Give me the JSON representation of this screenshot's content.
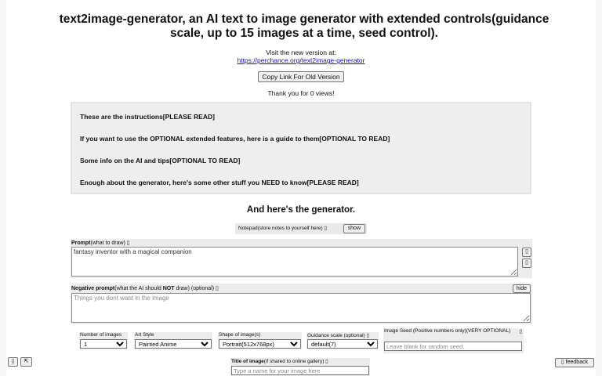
{
  "header": {
    "title": "text2image-generator, an AI text to image generator with extended controls(guidance scale, up to 15 images at a time, seed control)."
  },
  "visit": {
    "text": "Visit the new version at:",
    "link": "https://perchance.org/text2image-generator"
  },
  "copy_button": "Copy Link For Old Version",
  "views": {
    "prefix": "Thank you for ",
    "count": "0",
    "suffix": " views!"
  },
  "info_sections": [
    "These are the instructions[PLEASE READ]",
    "If you want to use the OPTIONAL extended features, here is a guide to them[OPTIONAL TO READ]",
    "Some info on the AI and tips[OPTIONAL TO READ]",
    "Enough about the generator, here's some other stuff you NEED to know[PLEASE READ]"
  ],
  "generator_heading": "And here's the generator.",
  "notepad": {
    "label": "Notepad(store notes to yourself here) ▯",
    "button": "show"
  },
  "prompt": {
    "label_bold": "Prompt",
    "label_rest": "(what to draw) ▯",
    "value": "fantasy inventor with a magical companion",
    "side_buttons": [
      "▯",
      "▯"
    ]
  },
  "negative_prompt": {
    "label_bold1": "Negative prompt",
    "label_mid": "(what the AI should ",
    "label_bold2": "NOT",
    "label_rest": " draw) (optional) ▯",
    "placeholder": "Things you dont want in the image",
    "hide_button": "hide"
  },
  "options": {
    "num_images": {
      "label": "Number of images",
      "value": "1"
    },
    "art_style": {
      "label": "Art Style",
      "value": "Painted Anime"
    },
    "shape": {
      "label": "Shape of image(s)",
      "value": "Portrait(512x768px)"
    },
    "guidance": {
      "label": "Guidance scale (optional) ▯",
      "value": "default(7)"
    },
    "seed": {
      "label": "Image Seed (Positive numbers only)(VERY OPTIONAL)",
      "label_icon": "▯",
      "placeholder": "Leave blank for random seed."
    }
  },
  "title_of_image": {
    "label_bold": "Title of image",
    "label_rest": "(if shared to online gallery) ▯",
    "placeholder": "Type a name for your image here"
  },
  "corner": {
    "left1": "▯",
    "left2": "⇱",
    "feedback": "▯ feedback"
  }
}
